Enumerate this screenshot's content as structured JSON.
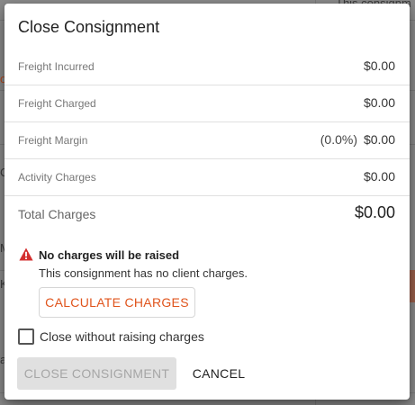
{
  "dialog": {
    "title": "Close Consignment",
    "rows": [
      {
        "label": "Freight Incurred",
        "value": "$0.00"
      },
      {
        "label": "Freight Charged",
        "value": "$0.00"
      },
      {
        "label": "Freight Margin",
        "percent": "(0.0%)",
        "value": "$0.00"
      },
      {
        "label": "Activity Charges",
        "value": "$0.00"
      }
    ],
    "total": {
      "label": "Total Charges",
      "value": "$0.00"
    },
    "warning": {
      "icon": "warning-triangle-icon",
      "title": "No charges will be raised",
      "message": "This consignment has no client charges."
    },
    "calculate_label": "CALCULATE CHARGES",
    "checkbox": {
      "label": "Close without raising charges",
      "checked": false
    },
    "actions": {
      "close_label": "CLOSE CONSIGNMENT",
      "close_disabled": true,
      "cancel_label": "CANCEL"
    }
  },
  "background": {
    "fragments": [
      "This consignm",
      "o",
      "C",
      "M",
      "K",
      "a"
    ]
  },
  "colors": {
    "accent": "#e0541c",
    "warning": "#d32f2f",
    "disabled_bg": "#e0e0e0",
    "disabled_text": "#a6a6a6"
  }
}
